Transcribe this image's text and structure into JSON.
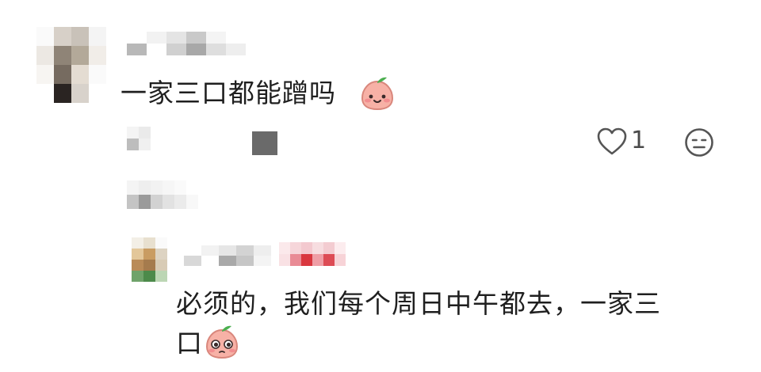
{
  "comment": {
    "text": "一家三口都能蹭吗",
    "emoji": "peach-smile-emoji",
    "likes": "1"
  },
  "reply": {
    "text_line1": "必须的，我们每个周日中午都去，一家三",
    "text_line2": "口",
    "emoji": "peach-pleading-emoji"
  },
  "colors": {
    "text": "#1f1f1f",
    "icon": "#555555",
    "peach": "#f6a9a0",
    "leaf": "#4caf50",
    "badge_red": "#d9373f"
  }
}
